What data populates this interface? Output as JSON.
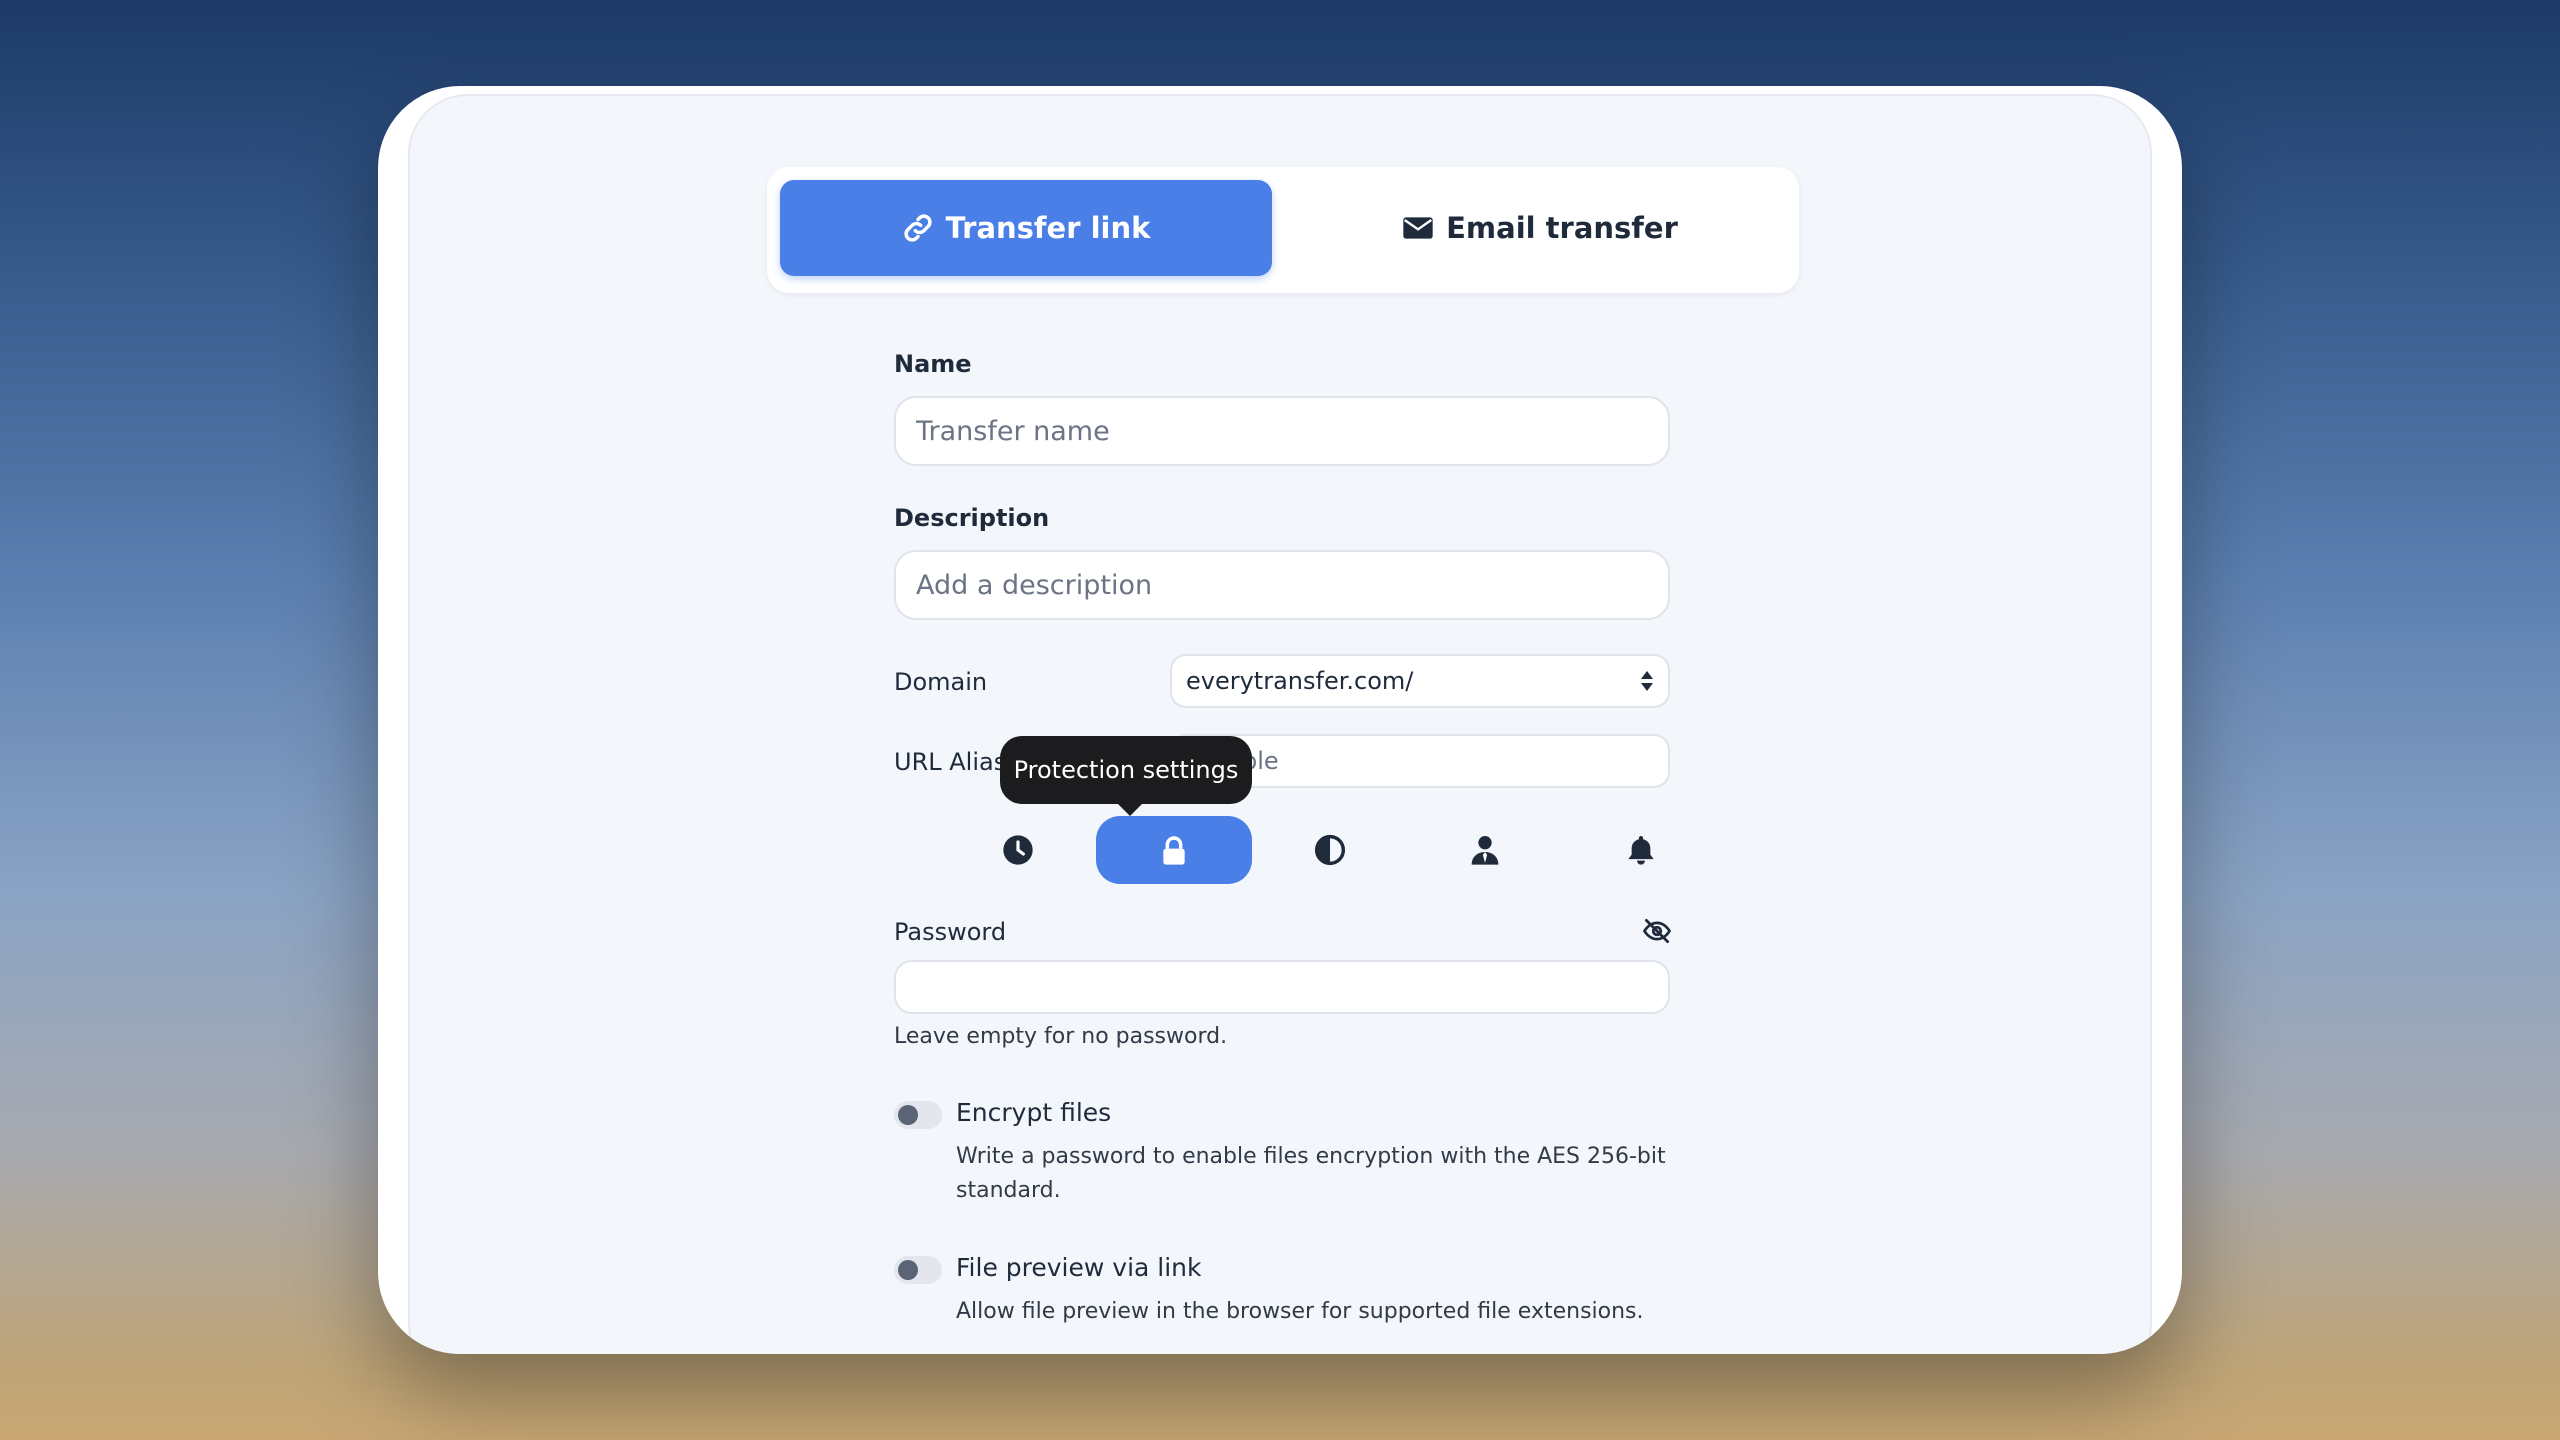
{
  "tabs": {
    "transfer_link": "Transfer link",
    "email_transfer": "Email transfer"
  },
  "form": {
    "name_label": "Name",
    "name_placeholder": "Transfer name",
    "description_label": "Description",
    "description_placeholder": "Add a description",
    "domain_label": "Domain",
    "domain_value": "everytransfer.com/",
    "url_alias_label": "URL Alias",
    "url_alias_visible_placeholder": "ple",
    "tooltip": "Protection settings",
    "password_label": "Password",
    "password_value": "",
    "password_hint": "Leave empty for no password.",
    "encrypt": {
      "title": "Encrypt files",
      "desc_line1": "Write a password to enable files encryption with the AES 256-bit",
      "desc_line2": "standard.",
      "enabled": false
    },
    "preview": {
      "title": "File preview via link",
      "desc": "Allow file preview in the browser for supported file extensions.",
      "enabled": false
    }
  },
  "option_buttons": [
    {
      "icon": "clock-icon",
      "active": false
    },
    {
      "icon": "lock-icon",
      "active": true
    },
    {
      "icon": "contrast-icon",
      "active": false
    },
    {
      "icon": "user-tie-icon",
      "active": false
    },
    {
      "icon": "bell-icon",
      "active": false
    }
  ],
  "colors": {
    "accent": "#4a7fe8",
    "panel_bg": "#f3f6fb",
    "text": "#1f2a3b",
    "tooltip_bg": "#1c1c1e"
  }
}
